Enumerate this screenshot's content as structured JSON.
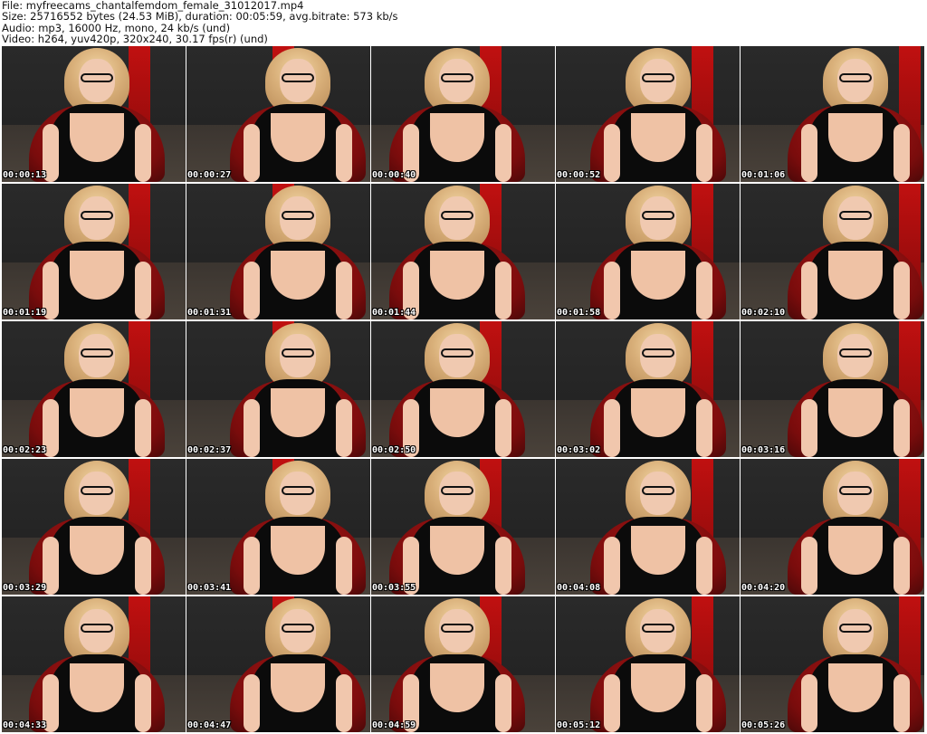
{
  "header": {
    "line1": "File: myfreecams_chantalfemdom_female_31012017.mp4",
    "line2": "Size: 25716552 bytes (24.53 MiB), duration: 00:05:59, avg.bitrate: 573 kb/s",
    "line3": "Audio: mp3, 16000 Hz, mono, 24 kb/s (und)",
    "line4": "Video: h264, yuv420p, 320x240, 30.17 fps(r) (und)"
  },
  "thumbnails": [
    {
      "timestamp": "00:00:13"
    },
    {
      "timestamp": "00:00:27"
    },
    {
      "timestamp": "00:00:40"
    },
    {
      "timestamp": "00:00:52"
    },
    {
      "timestamp": "00:01:06"
    },
    {
      "timestamp": "00:01:19"
    },
    {
      "timestamp": "00:01:31"
    },
    {
      "timestamp": "00:01:44"
    },
    {
      "timestamp": "00:01:58"
    },
    {
      "timestamp": "00:02:10"
    },
    {
      "timestamp": "00:02:23"
    },
    {
      "timestamp": "00:02:37"
    },
    {
      "timestamp": "00:02:50"
    },
    {
      "timestamp": "00:03:02"
    },
    {
      "timestamp": "00:03:16"
    },
    {
      "timestamp": "00:03:29"
    },
    {
      "timestamp": "00:03:41"
    },
    {
      "timestamp": "00:03:55"
    },
    {
      "timestamp": "00:04:08"
    },
    {
      "timestamp": "00:04:20"
    },
    {
      "timestamp": "00:04:33"
    },
    {
      "timestamp": "00:04:47"
    },
    {
      "timestamp": "00:04:59"
    },
    {
      "timestamp": "00:05:12"
    },
    {
      "timestamp": "00:05:26"
    }
  ]
}
